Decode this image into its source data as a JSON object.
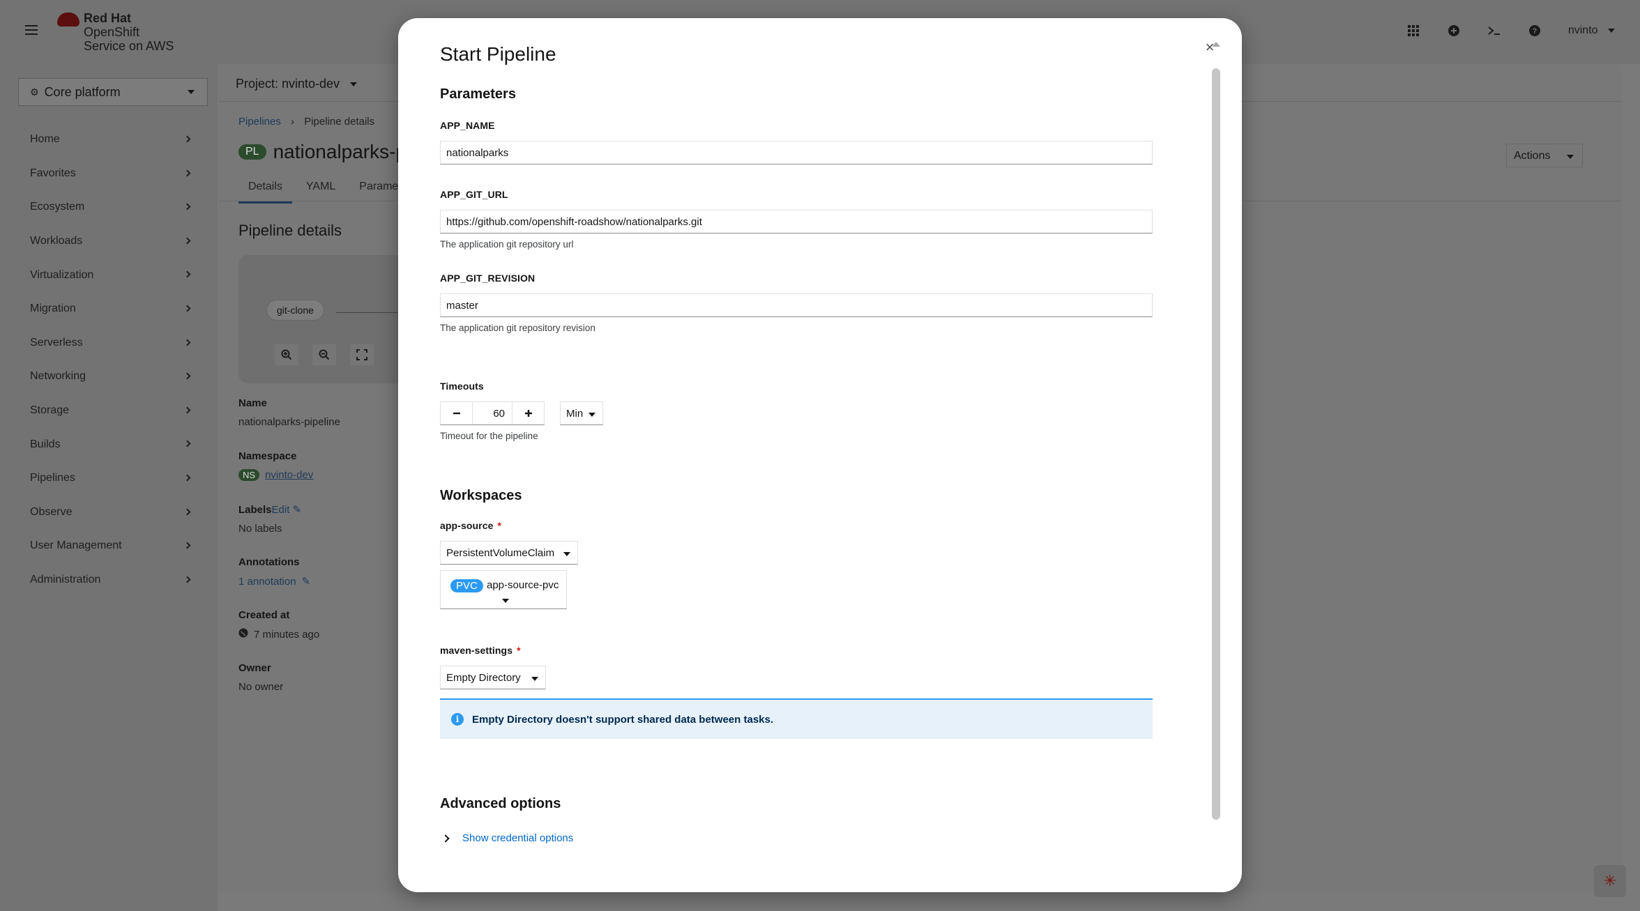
{
  "masthead": {
    "brand_line1": "Red Hat",
    "brand_line2": "OpenShift",
    "brand_line3": "Service on AWS",
    "user": "nvinto",
    "icons": [
      "grid-icon",
      "plus-circle-icon",
      "terminal-icon",
      "help-icon"
    ]
  },
  "sidebar": {
    "perspective": "Core platform",
    "items": [
      {
        "label": "Home"
      },
      {
        "label": "Favorites"
      },
      {
        "label": "Ecosystem"
      },
      {
        "label": "Workloads"
      },
      {
        "label": "Virtualization"
      },
      {
        "label": "Migration"
      },
      {
        "label": "Serverless"
      },
      {
        "label": "Networking"
      },
      {
        "label": "Storage"
      },
      {
        "label": "Builds"
      },
      {
        "label": "Pipelines"
      },
      {
        "label": "Observe"
      },
      {
        "label": "User Management"
      },
      {
        "label": "Administration"
      }
    ]
  },
  "page": {
    "project": "Project: nvinto-dev",
    "breadcrumb_root": "Pipelines",
    "breadcrumb_current": "Pipeline details",
    "badge": "PL",
    "title": "nationalparks-p",
    "actions": "Actions",
    "tabs": [
      "Details",
      "YAML",
      "Paramete"
    ],
    "section_title": "Pipeline details",
    "graph_node": "git-clone",
    "name_label": "Name",
    "name_value": "nationalparks-pipeline",
    "namespace_label": "Namespace",
    "namespace_badge": "NS",
    "namespace_value": "nvinto-dev",
    "labels_label": "Labels",
    "labels_edit": "Edit",
    "labels_value": "No labels",
    "annotations_label": "Annotations",
    "annotations_value": "1 annotation",
    "created_label": "Created at",
    "created_value": "7 minutes ago",
    "owner_label": "Owner",
    "owner_value": "No owner"
  },
  "modal": {
    "title": "Start Pipeline",
    "parameters_heading": "Parameters",
    "params": [
      {
        "label": "APP_NAME",
        "value": "nationalparks",
        "help": ""
      },
      {
        "label": "APP_GIT_URL",
        "value": "https://github.com/openshift-roadshow/nationalparks.git",
        "help": "The application git repository url"
      },
      {
        "label": "APP_GIT_REVISION",
        "value": "master",
        "help": "The application git repository revision"
      }
    ],
    "timeouts_label": "Timeouts",
    "timeout_value": "60",
    "timeout_unit": "Min",
    "timeout_help": "Timeout for the pipeline",
    "workspaces_heading": "Workspaces",
    "ws_app_source_label": "app-source",
    "ws_app_source_type": "PersistentVolumeClaim",
    "pvc_badge": "PVC",
    "pvc_name": "app-source-pvc",
    "ws_maven_label": "maven-settings",
    "ws_maven_type": "Empty Directory",
    "required_mark": "*",
    "alert_text": "Empty Directory doesn't support shared data between tasks.",
    "advanced_heading": "Advanced options",
    "show_credentials": "Show credential options"
  },
  "colors": {
    "accent": "#0066cc",
    "info": "#2b9af3",
    "info_bg": "#e7f1fa",
    "required": "#c9190b"
  }
}
